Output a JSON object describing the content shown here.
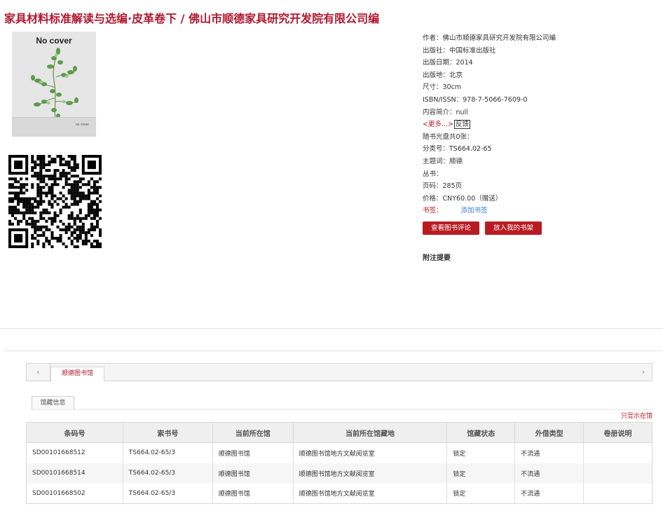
{
  "book": {
    "title": "家具材料标准解读与选编·皮革卷下 / 佛山市顺德家具研究开发院有限公司编",
    "cover": {
      "top_text": "No cover",
      "bottom_text": "no cover"
    }
  },
  "meta": {
    "author": "作者：佛山市顺德家具研究开发院有限公司编",
    "publisher": "出版社：中国标准出版社",
    "pub_date": "出版日期：2014",
    "pub_place": "出版地：北京",
    "size": "尺寸：30cm",
    "isbn": "ISBN/ISSN：978-7-5066-7609-0",
    "summary": "内容简介：null",
    "more_link": "<更多...>",
    "feedback": "反馈",
    "disc": "随书光盘共0张：",
    "class_no": "分类号：TS664.02-65",
    "subject": "主题词：顺德",
    "series": "丛书：",
    "pages": "页码：285页",
    "price": "价格：CNY60.00（赠送）",
    "bookmark_label": "书签：",
    "add_tag": "添加书签"
  },
  "buttons": {
    "review": "查看图书评论",
    "shelf": "放入我的书架"
  },
  "notes_heading": "附注提要",
  "holdings": {
    "tab": "顺德图书馆",
    "subtab": "馆藏信息",
    "only_mine": "只显示在馆",
    "nav": {
      "left": "‹",
      "right": "›"
    },
    "columns": [
      "条码号",
      "索书号",
      "当前所在馆",
      "当前所在馆藏地",
      "馆藏状态",
      "外借类型",
      "卷册说明"
    ],
    "rows": [
      [
        "SD00101668512",
        "TS664.02-65/3",
        "顺德图书馆",
        "顺德图书馆地方文献阅览室",
        "锁定",
        "不流通",
        ""
      ],
      [
        "SD00101668514",
        "TS664.02-65/3",
        "顺德图书馆",
        "顺德图书馆地方文献阅览室",
        "锁定",
        "不流通",
        ""
      ],
      [
        "SD00101668502",
        "TS664.02-65/3",
        "顺德图书馆",
        "顺德图书馆地方文献阅览室",
        "锁定",
        "不流通",
        ""
      ]
    ]
  }
}
